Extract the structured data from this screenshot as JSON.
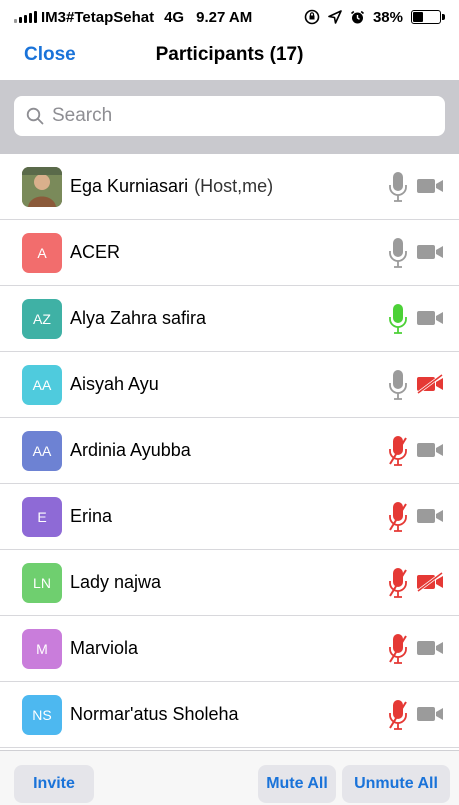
{
  "status_bar": {
    "carrier": "IM3#TetapSehat",
    "network": "4G",
    "time": "9.27 AM",
    "battery": "38%",
    "battery_level": 0.38
  },
  "nav": {
    "close_label": "Close",
    "title": "Participants (17)"
  },
  "search": {
    "placeholder": "Search"
  },
  "participants": [
    {
      "name": "Ega Kurniasari",
      "role": "(Host,me)",
      "initials": "",
      "avatar": "photo",
      "avatar_color": "#8b6a4a",
      "mic": "available",
      "video": "off"
    },
    {
      "name": "ACER",
      "role": "",
      "initials": "A",
      "avatar_color": "#f26d6d",
      "mic": "available",
      "video": "off"
    },
    {
      "name": "Alya Zahra safira",
      "role": "",
      "initials": "AZ",
      "avatar_color": "#3fb1a5",
      "mic": "speaking",
      "video": "off"
    },
    {
      "name": "Aisyah Ayu",
      "role": "",
      "initials": "AA",
      "avatar_color": "#4fcbdd",
      "mic": "available",
      "video": "disabled"
    },
    {
      "name": "Ardinia Ayubba",
      "role": "",
      "initials": "AA",
      "avatar_color": "#6d82d3",
      "mic": "muted",
      "video": "off"
    },
    {
      "name": "Erina",
      "role": "",
      "initials": "E",
      "avatar_color": "#8e6ad6",
      "mic": "muted",
      "video": "off"
    },
    {
      "name": "Lady najwa",
      "role": "",
      "initials": "LN",
      "avatar_color": "#6fcf6f",
      "mic": "muted",
      "video": "disabled"
    },
    {
      "name": "Marviola",
      "role": "",
      "initials": "M",
      "avatar_color": "#c97ddb",
      "mic": "muted",
      "video": "off"
    },
    {
      "name": "Normar'atus Sholeha",
      "role": "",
      "initials": "NS",
      "avatar_color": "#4db8f0",
      "mic": "muted",
      "video": "off"
    }
  ],
  "colors": {
    "accent": "#1a73d9",
    "mic_gray": "#9b9b9b",
    "mic_speaking": "#4cd137",
    "muted_red": "#e53935",
    "cam_gray": "#9b9b9b"
  },
  "toolbar": {
    "invite_label": "Invite",
    "mute_all_label": "Mute All",
    "unmute_all_label": "Unmute All"
  }
}
